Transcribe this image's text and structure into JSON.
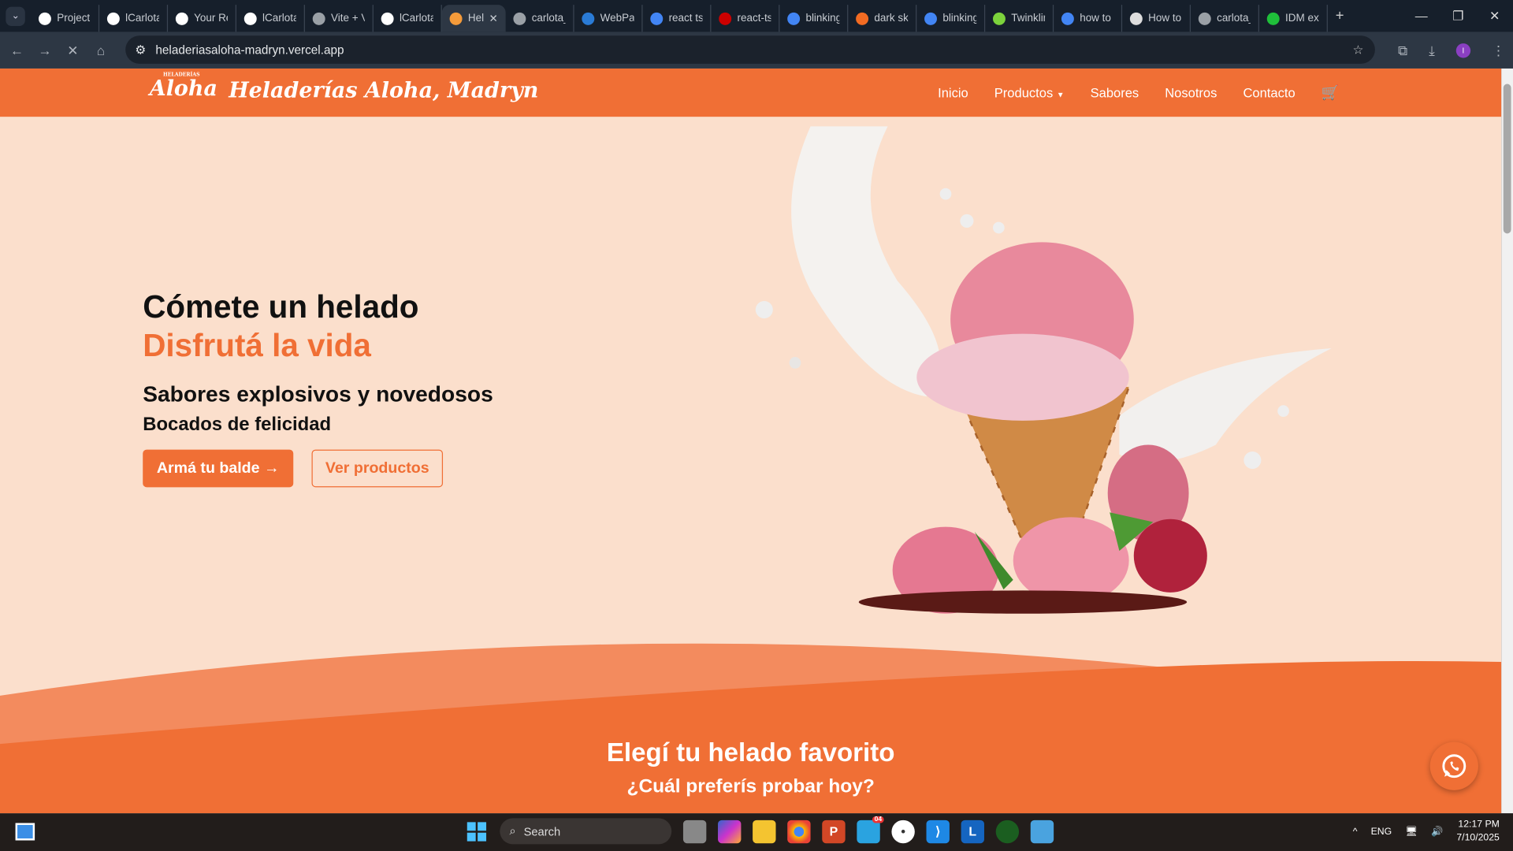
{
  "browser": {
    "tabs": [
      {
        "label": "Project",
        "color": "#ffffff"
      },
      {
        "label": "lCarlota",
        "color": "#ffffff"
      },
      {
        "label": "Your Re",
        "color": "#ffffff"
      },
      {
        "label": "lCarlota",
        "color": "#ffffff"
      },
      {
        "label": "Vite + V",
        "color": "#9aa0a6"
      },
      {
        "label": "lCarlota",
        "color": "#ffffff"
      },
      {
        "label": "Hel",
        "color": "#f59b3a",
        "active": true
      },
      {
        "label": "carlota_",
        "color": "#9aa0a6"
      },
      {
        "label": "WebPag",
        "color": "#2a7bd6"
      },
      {
        "label": "react ts",
        "color": "#4285f4"
      },
      {
        "label": "react-ts",
        "color": "#cc0000"
      },
      {
        "label": "blinking",
        "color": "#4285f4"
      },
      {
        "label": "dark sky",
        "color": "#f26b22"
      },
      {
        "label": "blinking",
        "color": "#4285f4"
      },
      {
        "label": "Twinklin",
        "color": "#7cd23c"
      },
      {
        "label": "how to",
        "color": "#4285f4"
      },
      {
        "label": "How to",
        "color": "#dddddd"
      },
      {
        "label": "carlota_",
        "color": "#9aa0a6"
      },
      {
        "label": "IDM ext",
        "color": "#1fbf3a"
      }
    ],
    "url": "heladeriasaloha-madryn.vercel.app",
    "profile_initial": "I"
  },
  "site": {
    "logo": "Aloha",
    "logo_small": "HELADERÍAS",
    "brand": "Heladerías Aloha, Madryn",
    "nav": [
      "Inicio",
      "Productos",
      "Sabores",
      "Nosotros",
      "Contacto"
    ],
    "hero": {
      "line1": "Cómete un helado",
      "line2": "Disfrutá la vida",
      "sub1": "Sabores explosivos y novedosos",
      "sub2": "Bocados de felicidad",
      "primary_button": "Armá tu balde →",
      "secondary_button": "Ver productos"
    },
    "section": {
      "title": "Elegí tu helado favorito",
      "subtitle": "¿Cuál preferís probar hoy?"
    },
    "colors": {
      "accent": "#f06f35",
      "hero_bg": "#fbdfcc"
    }
  },
  "taskbar": {
    "search": "Search",
    "lang": "ENG",
    "time": "12:17 PM",
    "date": "7/10/2025",
    "badge": "04"
  }
}
